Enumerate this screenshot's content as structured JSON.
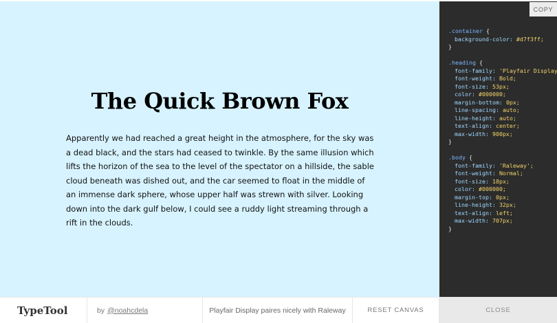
{
  "canvas": {
    "heading": "The Quick Brown Fox",
    "body": "Apparently we had reached a great height in the atmosphere, for the sky was a dead black, and the stars had ceased to twinkle. By the same illusion which lifts the horizon of the sea to the level of the spectator on a hillside, the sable cloud beneath was dished out, and the car seemed to float in the middle of an immense dark sphere, whose upper half was strewn with silver. Looking down into the dark gulf below, I could see a ruddy light streaming through a rift in the clouds.",
    "background_color": "#d7f3ff"
  },
  "code_panel": {
    "copy_label": "COPY",
    "blocks": [
      {
        "selector": ".container {",
        "rules": [
          {
            "prop": "background-color:",
            "val": "#d7f3ff;"
          }
        ]
      },
      {
        "selector": ".heading {",
        "rules": [
          {
            "prop": "font-family:",
            "val": "'Playfair Display';"
          },
          {
            "prop": "font-weight:",
            "val": "Bold;"
          },
          {
            "prop": "font-size:",
            "val": "53px;"
          },
          {
            "prop": "color:",
            "val": "#000000;"
          },
          {
            "prop": "margin-bottom:",
            "val": "0px;"
          },
          {
            "prop": "line-spacing:",
            "val": "auto;"
          },
          {
            "prop": "line-height:",
            "val": "auto;"
          },
          {
            "prop": "text-align:",
            "val": "center;"
          },
          {
            "prop": "max-width:",
            "val": "900px;"
          }
        ]
      },
      {
        "selector": ".body {",
        "rules": [
          {
            "prop": "font-family:",
            "val": "'Raleway';"
          },
          {
            "prop": "font-weight:",
            "val": "Normal;"
          },
          {
            "prop": "font-size:",
            "val": "18px;"
          },
          {
            "prop": "color:",
            "val": "#000000;"
          },
          {
            "prop": "margin-top:",
            "val": "0px;"
          },
          {
            "prop": "line-height:",
            "val": "32px;"
          },
          {
            "prop": "text-align:",
            "val": "left;"
          },
          {
            "prop": "max-width:",
            "val": "707px;"
          }
        ]
      }
    ],
    "close_brace": "}"
  },
  "bottom_bar": {
    "brand": "TypeTool",
    "author_prefix": "by",
    "author_link": "@noahcdela",
    "pairing_text": "Playfair Display paires nicely with Raleway",
    "reset_label": "RESET CANVAS",
    "close_label": "CLOSE"
  }
}
